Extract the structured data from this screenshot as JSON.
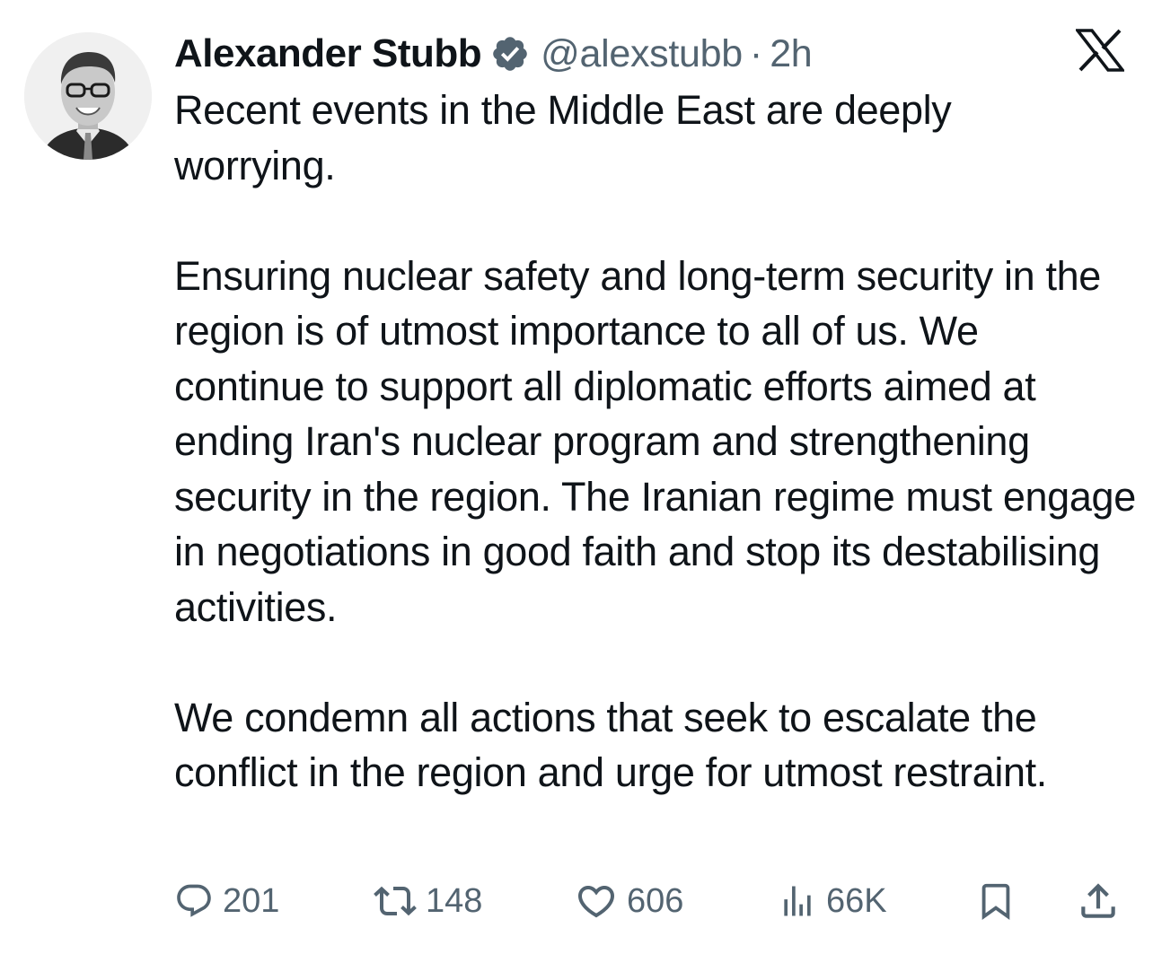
{
  "author": {
    "name": "Alexander Stubb",
    "handle": "@alexstubb",
    "separator": "·",
    "time": "2h",
    "verified": true
  },
  "tweet": {
    "paragraphs": [
      "Recent events in the Middle East are deeply worrying.",
      "Ensuring nuclear safety and long-term security in the region is of utmost importance to all of us. We continue to support all diplomatic efforts aimed at ending Iran's nuclear program and strengthening security in the region. The Iranian regime must engage in negotiations in good faith and stop its destabilising activities.",
      "We condemn all actions that seek to escalate the conflict in the region and urge for utmost restraint."
    ]
  },
  "actions": {
    "replies": "201",
    "reposts": "148",
    "likes": "606",
    "views": "66K"
  },
  "icons": {
    "platform": "x-logo-icon",
    "verified": "verified-badge-icon",
    "reply": "reply-icon",
    "repost": "repost-icon",
    "like": "heart-icon",
    "views": "views-icon",
    "bookmark": "bookmark-icon",
    "share": "share-icon"
  },
  "colors": {
    "text": "#0f1419",
    "secondary": "#536471",
    "verified_badge": "#536471",
    "background": "#ffffff"
  }
}
